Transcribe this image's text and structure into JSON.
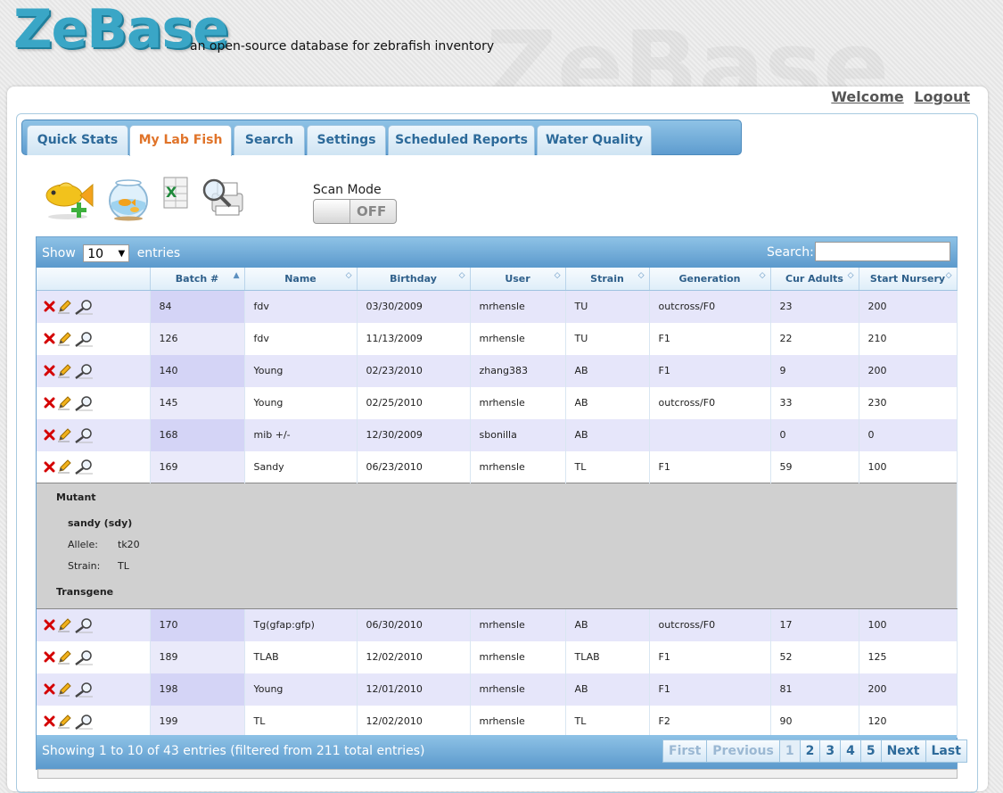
{
  "app": {
    "logo": "ZeBase",
    "tagline": "an open-source database for zebrafish inventory",
    "watermark": "ZeBase"
  },
  "user_links": {
    "welcome": "Welcome",
    "logout": "Logout"
  },
  "tabs": [
    {
      "label": "Quick Stats"
    },
    {
      "label": "My Lab Fish"
    },
    {
      "label": "Search"
    },
    {
      "label": "Settings"
    },
    {
      "label": "Scheduled Reports"
    },
    {
      "label": "Water Quality"
    }
  ],
  "active_tab": "My Lab Fish",
  "toolbar": {
    "icons": [
      "add-fish-icon",
      "fish-tank-icon",
      "excel-export-icon",
      "print-preview-icon"
    ],
    "scan_mode_label": "Scan Mode",
    "scan_mode_state": "OFF"
  },
  "table": {
    "show_label": "Show",
    "entries_label": "entries",
    "page_size": "10",
    "search_label": "Search:",
    "search_value": "",
    "columns": [
      "",
      "Batch #",
      "Name",
      "Birthday",
      "User",
      "Strain",
      "Generation",
      "Cur Adults",
      "Start Nursery"
    ],
    "rows": [
      {
        "batch": "84",
        "name": "fdv",
        "birthday": "03/30/2009",
        "user": "mrhensle",
        "strain": "TU",
        "generation": "outcross/F0",
        "cur_adults": "23",
        "start_nursery": "200"
      },
      {
        "batch": "126",
        "name": "fdv",
        "birthday": "11/13/2009",
        "user": "mrhensle",
        "strain": "TU",
        "generation": "F1",
        "cur_adults": "22",
        "start_nursery": "210"
      },
      {
        "batch": "140",
        "name": "Young",
        "birthday": "02/23/2010",
        "user": "zhang383",
        "strain": "AB",
        "generation": "F1",
        "cur_adults": "9",
        "start_nursery": "200"
      },
      {
        "batch": "145",
        "name": "Young",
        "birthday": "02/25/2010",
        "user": "mrhensle",
        "strain": "AB",
        "generation": "outcross/F0",
        "cur_adults": "33",
        "start_nursery": "230"
      },
      {
        "batch": "168",
        "name": "mib +/-",
        "birthday": "12/30/2009",
        "user": "sbonilla",
        "strain": "AB",
        "generation": "",
        "cur_adults": "0",
        "start_nursery": "0"
      },
      {
        "batch": "169",
        "name": "Sandy",
        "birthday": "06/23/2010",
        "user": "mrhensle",
        "strain": "TL",
        "generation": "F1",
        "cur_adults": "59",
        "start_nursery": "100"
      },
      {
        "batch": "170",
        "name": "Tg(gfap:gfp)",
        "birthday": "06/30/2010",
        "user": "mrhensle",
        "strain": "AB",
        "generation": "outcross/F0",
        "cur_adults": "17",
        "start_nursery": "100"
      },
      {
        "batch": "189",
        "name": "TLAB",
        "birthday": "12/02/2010",
        "user": "mrhensle",
        "strain": "TLAB",
        "generation": "F1",
        "cur_adults": "52",
        "start_nursery": "125"
      },
      {
        "batch": "198",
        "name": "Young",
        "birthday": "12/01/2010",
        "user": "mrhensle",
        "strain": "AB",
        "generation": "F1",
        "cur_adults": "81",
        "start_nursery": "200"
      },
      {
        "batch": "199",
        "name": "TL",
        "birthday": "12/02/2010",
        "user": "mrhensle",
        "strain": "TL",
        "generation": "F2",
        "cur_adults": "90",
        "start_nursery": "120"
      }
    ],
    "detail": {
      "mutant_heading": "Mutant",
      "mutant_name": "sandy (sdy)",
      "allele_label": "Allele:",
      "allele_value": "tk20",
      "strain_label": "Strain:",
      "strain_value": "TL",
      "transgene_heading": "Transgene"
    },
    "info": "Showing 1 to 10 of 43 entries (filtered from 211 total entries)",
    "pagination": {
      "first": "First",
      "previous": "Previous",
      "pages": [
        "1",
        "2",
        "3",
        "4",
        "5"
      ],
      "current": "1",
      "next": "Next",
      "last": "Last"
    }
  }
}
